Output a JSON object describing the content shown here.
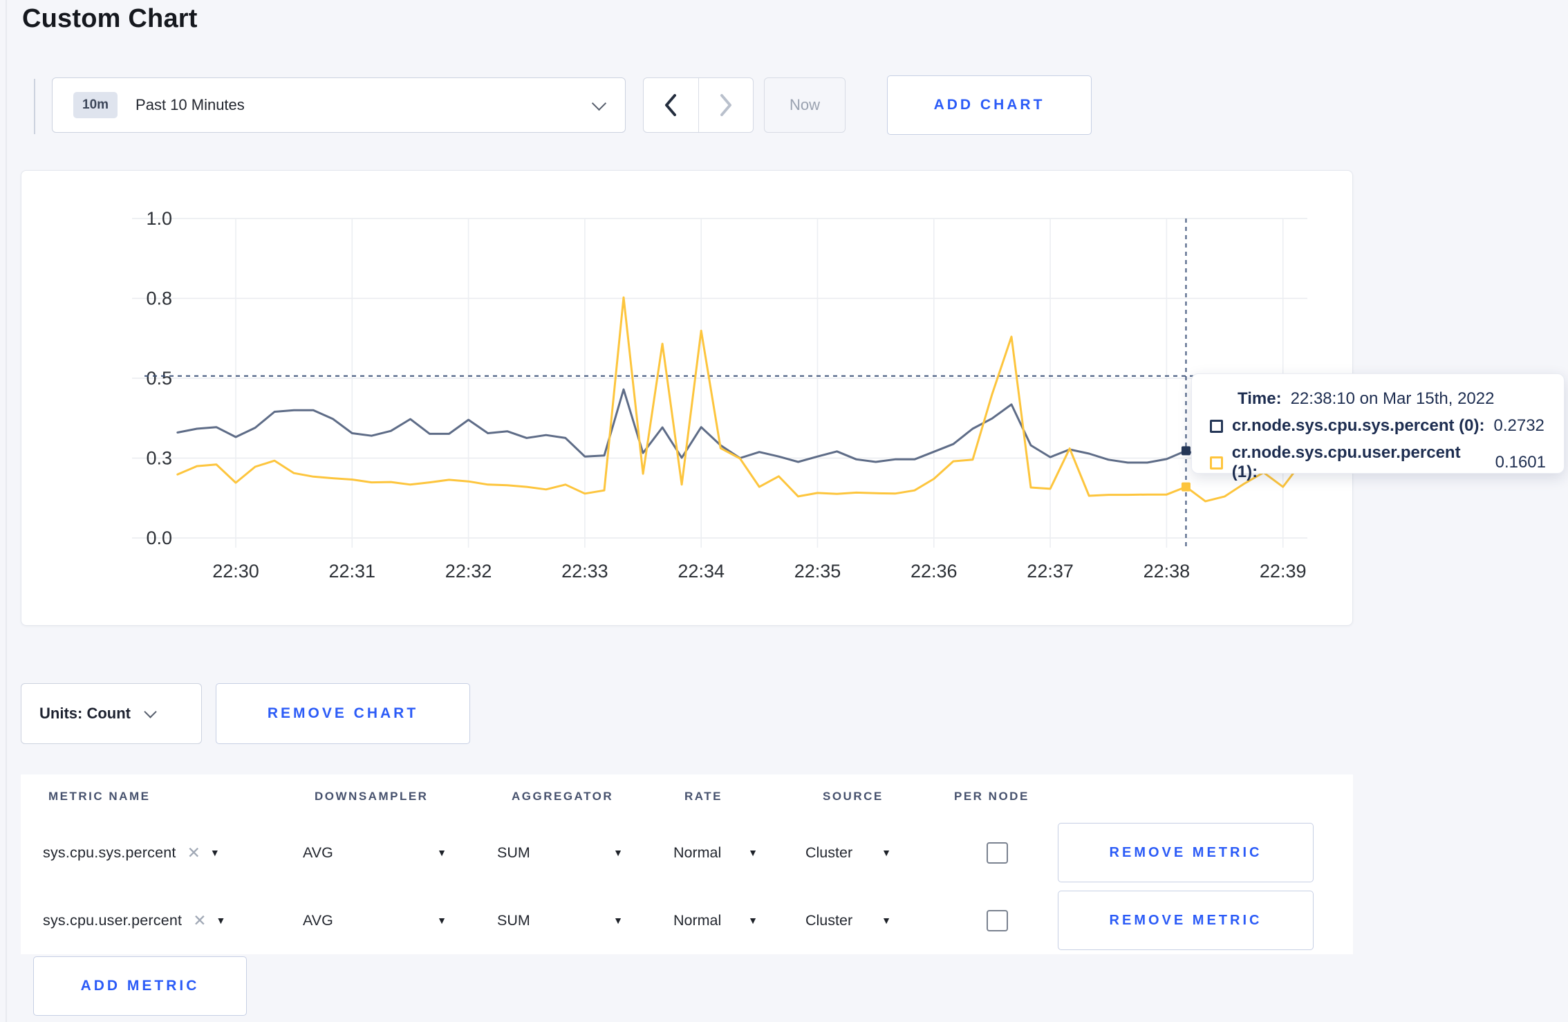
{
  "page": {
    "title": "Custom Chart"
  },
  "icons": {
    "clear": "✕",
    "select_arrow": "▼"
  },
  "toolbar": {
    "time_badge": "10m",
    "time_label": "Past 10 Minutes",
    "now_label": "Now",
    "add_chart_label": "ADD CHART"
  },
  "chart_controls": {
    "units_label": "Units: Count",
    "remove_chart_label": "REMOVE CHART"
  },
  "tooltip": {
    "time_label": "Time:",
    "time_value": "22:38:10 on Mar 15th, 2022",
    "rows": [
      {
        "label": "cr.node.sys.cpu.sys.percent (0):",
        "value": "0.2732",
        "swatch_color": "#253757"
      },
      {
        "label": "cr.node.sys.cpu.user.percent (1):",
        "value": "0.1601",
        "swatch_color": "#ffc53d"
      }
    ]
  },
  "chart_data": {
    "type": "line",
    "title": "",
    "xlabel": "",
    "ylabel": "",
    "ylim": [
      0,
      1
    ],
    "grid": true,
    "legend_position": "tooltip-only",
    "x_ticks": [
      "22:30",
      "22:31",
      "22:32",
      "22:33",
      "22:34",
      "22:35",
      "22:36",
      "22:37",
      "22:38",
      "22:39"
    ],
    "y_tick_labels": [
      "1.0",
      "0.8",
      "0.5",
      "0.3",
      "0.0"
    ],
    "y_tick_values": [
      1.0,
      0.75,
      0.5,
      0.25,
      0.0
    ],
    "start_time": "22:29:30",
    "sample_interval_seconds": 10,
    "series": [
      {
        "name": "cr.node.sys.cpu.sys.percent",
        "color": "#5e6c87",
        "dot_color": "#253757",
        "values": [
          0.33,
          0.342,
          0.347,
          0.316,
          0.345,
          0.395,
          0.4,
          0.4,
          0.373,
          0.328,
          0.32,
          0.335,
          0.372,
          0.326,
          0.326,
          0.37,
          0.328,
          0.334,
          0.313,
          0.322,
          0.313,
          0.255,
          0.258,
          0.465,
          0.266,
          0.346,
          0.251,
          0.347,
          0.29,
          0.25,
          0.269,
          0.255,
          0.238,
          0.255,
          0.271,
          0.246,
          0.238,
          0.246,
          0.246,
          0.27,
          0.294,
          0.342,
          0.374,
          0.418,
          0.29,
          0.253,
          0.277,
          0.264,
          0.245,
          0.236,
          0.236,
          0.247,
          0.273,
          0.253,
          0.27,
          0.29,
          0.3,
          0.295,
          0.3
        ]
      },
      {
        "name": "cr.node.sys.cpu.user.percent",
        "color": "#fdc53d",
        "dot_color": "#fdc53d",
        "values": [
          0.199,
          0.225,
          0.23,
          0.173,
          0.223,
          0.242,
          0.203,
          0.192,
          0.187,
          0.183,
          0.174,
          0.175,
          0.167,
          0.174,
          0.182,
          0.177,
          0.167,
          0.165,
          0.16,
          0.152,
          0.167,
          0.139,
          0.149,
          0.753,
          0.201,
          0.608,
          0.167,
          0.649,
          0.281,
          0.249,
          0.16,
          0.193,
          0.13,
          0.141,
          0.138,
          0.142,
          0.14,
          0.139,
          0.149,
          0.185,
          0.24,
          0.245,
          0.45,
          0.63,
          0.158,
          0.154,
          0.28,
          0.132,
          0.135,
          0.135,
          0.136,
          0.136,
          0.16,
          0.115,
          0.13,
          0.17,
          0.205,
          0.16,
          0.24
        ]
      }
    ],
    "crosshair": {
      "index": 52,
      "time": "22:38:10",
      "y_value": 0.507,
      "highlighted": {
        "cr.node.sys.cpu.sys.percent": 0.2732,
        "cr.node.sys.cpu.user.percent": 0.1601
      }
    }
  },
  "metrics_table": {
    "headers": [
      "METRIC NAME",
      "DOWNSAMPLER",
      "AGGREGATOR",
      "RATE",
      "SOURCE",
      "PER NODE"
    ],
    "remove_metric_label": "REMOVE METRIC",
    "add_metric_label": "ADD METRIC",
    "rows": [
      {
        "name": "sys.cpu.sys.percent",
        "downsampler": "AVG",
        "aggregator": "SUM",
        "rate": "Normal",
        "source": "Cluster",
        "per_node": false
      },
      {
        "name": "sys.cpu.user.percent",
        "downsampler": "AVG",
        "aggregator": "SUM",
        "rate": "Normal",
        "source": "Cluster",
        "per_node": false
      }
    ]
  }
}
